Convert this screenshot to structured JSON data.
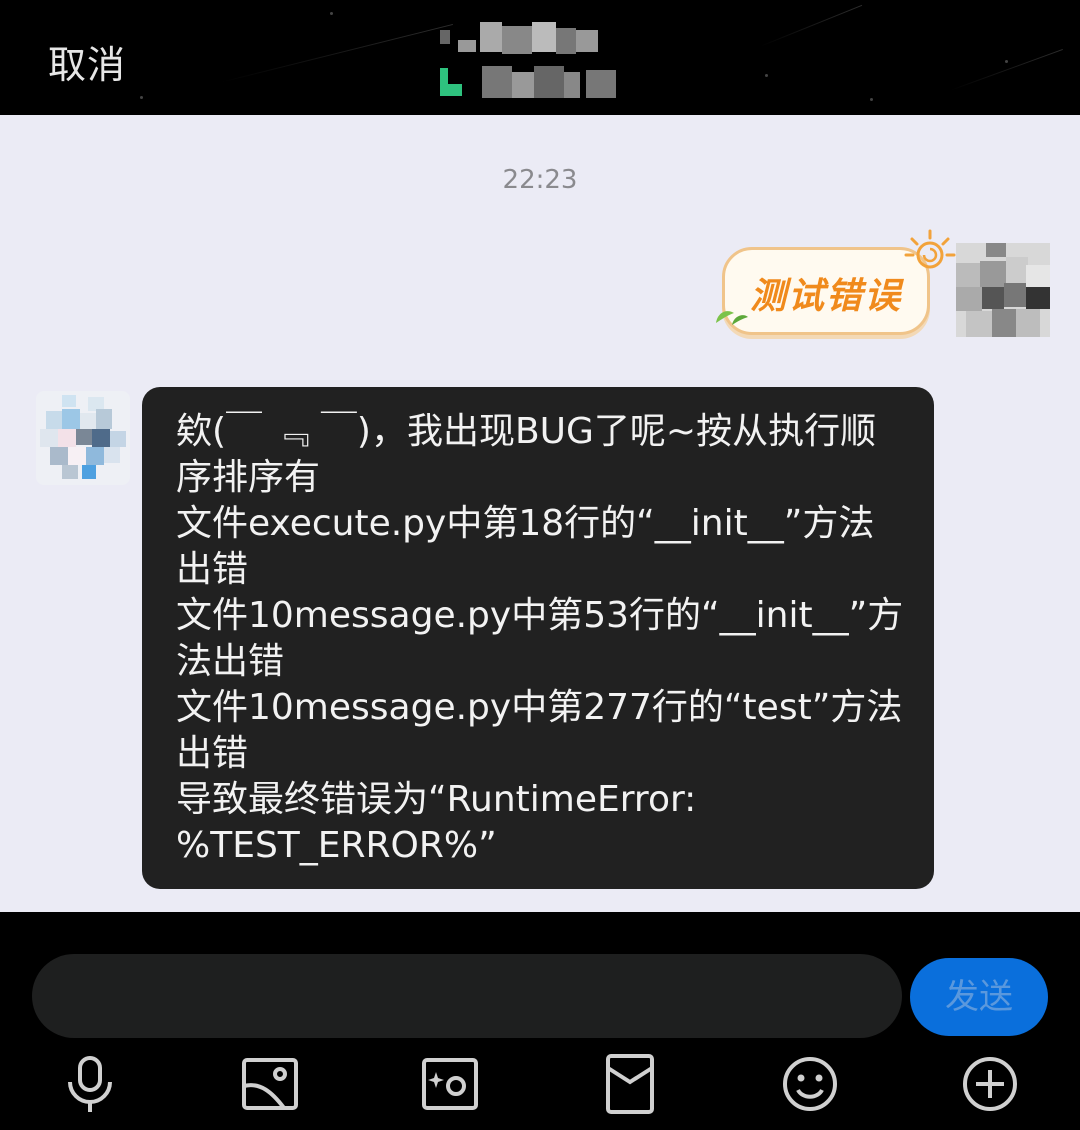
{
  "header": {
    "cancel_label": "取消"
  },
  "chat": {
    "timestamp": "22:23",
    "sent_sticker_text": "测试错误",
    "received_lines": [
      "欸(￣ ﹃ ￣)，我出现BUG了呢~按从执行顺",
      "序排序有",
      "文件execute.py中第18行的“__init__”方法",
      "出错",
      "文件10message.py中第53行的“__init__”方",
      "法出错",
      "文件10message.py中第277行的“test”方法",
      "出错",
      "导致最终错误为“RuntimeError:",
      "%TEST_ERROR%”"
    ]
  },
  "composer": {
    "input_value": "",
    "send_label": "发送"
  },
  "toolbar": {
    "icons": [
      "microphone-icon",
      "image-icon",
      "camera-icon",
      "red-packet-icon",
      "emoji-icon",
      "plus-icon"
    ]
  },
  "colors": {
    "chat_bg": "#ebebf5",
    "bubble_bg": "#212121",
    "send_button": "#0a6fdc",
    "sticker_text": "#f08a1c"
  }
}
